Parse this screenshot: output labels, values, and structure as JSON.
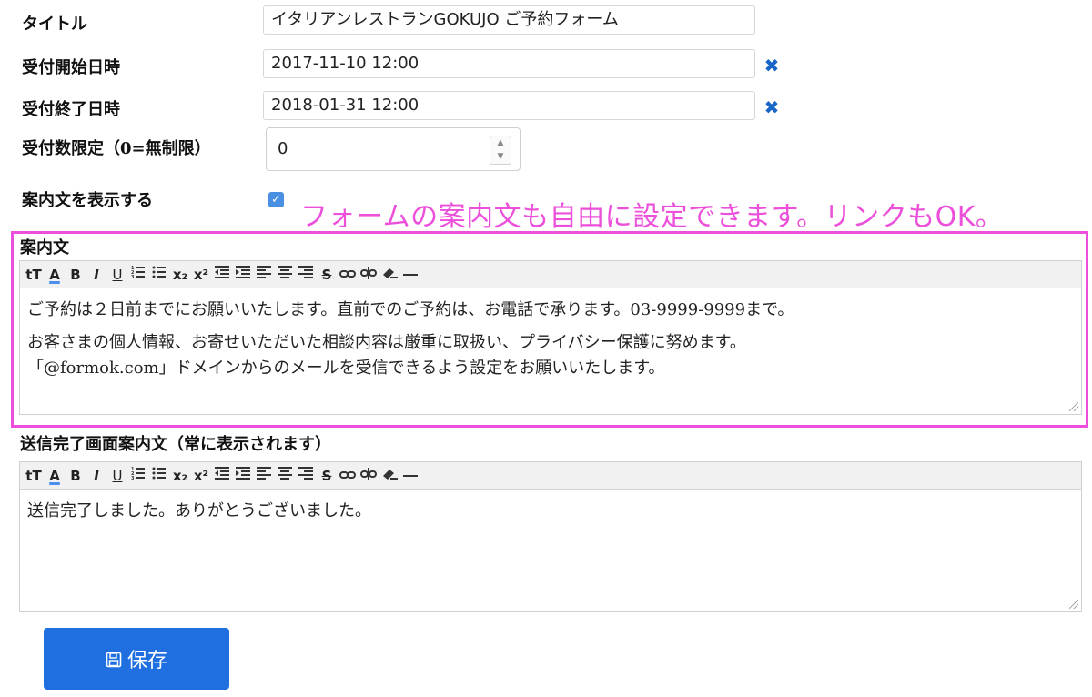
{
  "form": {
    "title": {
      "label": "タイトル",
      "value": "イタリアンレストランGOKUJO ご予約フォーム"
    },
    "start": {
      "label": "受付開始日時",
      "value": "2017-11-10 12:00",
      "clear": "✖"
    },
    "end": {
      "label": "受付終了日時",
      "value": "2018-01-31 12:00",
      "clear": "✖"
    },
    "limit": {
      "label": "受付数限定（0=無制限）",
      "value": "0"
    },
    "show_guide": {
      "label": "案内文を表示する",
      "checked": true,
      "check_glyph": "✓"
    }
  },
  "annotation": "フォームの案内文も自由に設定できます。リンクもOK。",
  "toolbar_items": [
    "tT",
    "A",
    "B",
    "I",
    "U",
    "ol",
    "ul",
    "x₂",
    "x²",
    "outdent",
    "left",
    "center",
    "right",
    "justify",
    "S",
    "link",
    "unlink",
    "eraser",
    "hr"
  ],
  "guide_editor": {
    "label": "案内文",
    "lines": [
      "ご予約は２日前までにお願いいたします。直前でのご予約は、お電話で承ります。03-9999-9999まで。",
      "お客さまの個人情報、お寄せいただいた相談内容は厳重に取扱い、プライバシー保護に努めます。",
      "「@formok.com」ドメインからのメールを受信できるよう設定をお願いいたします。"
    ]
  },
  "done_editor": {
    "label": "送信完了画面案内文（常に表示されます）",
    "lines": [
      "送信完了しました。ありがとうございました。"
    ]
  },
  "save_button": {
    "label": "保存",
    "icon": "floppy-disk-icon"
  },
  "colors": {
    "accent": "#1f6fe0",
    "annotation": "#ec4fd9",
    "clear": "#1a66c6"
  }
}
